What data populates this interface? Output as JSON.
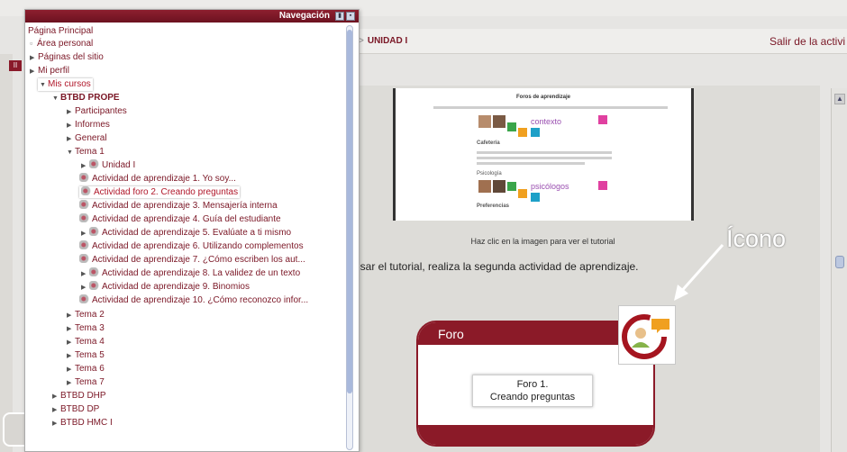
{
  "page": {
    "breadcrumb_sep": "i >",
    "breadcrumb": "UNIDAD I",
    "logout": "Salir de la activi",
    "left_badge": "II"
  },
  "nav": {
    "title": "Navegación",
    "items": [
      {
        "label": "Página Principal"
      },
      {
        "label": "Área personal"
      },
      {
        "label": "Páginas del sitio"
      },
      {
        "label": "Mi perfil"
      },
      {
        "label": "Mis cursos"
      },
      {
        "label": "BTBD PROPE"
      },
      {
        "label": "Participantes"
      },
      {
        "label": "Informes"
      },
      {
        "label": "General"
      },
      {
        "label": "Tema 1"
      },
      {
        "label": "Unidad I"
      },
      {
        "label": "Actividad de aprendizaje 1. Yo soy..."
      },
      {
        "label": "Actividad foro 2. Creando preguntas"
      },
      {
        "label": "Actividad de aprendizaje 3. Mensajería interna"
      },
      {
        "label": "Actividad de aprendizaje 4. Guía del estudiante"
      },
      {
        "label": "Actividad de aprendizaje 5. Evalúate a ti mismo"
      },
      {
        "label": "Actividad de aprendizaje 6. Utilizando complementos"
      },
      {
        "label": "Actividad de aprendizaje 7. ¿Cómo escriben los aut..."
      },
      {
        "label": "Actividad de aprendizaje 8. La validez de un texto"
      },
      {
        "label": "Actividad de aprendizaje 9. Binomios"
      },
      {
        "label": "Actividad de aprendizaje 10. ¿Cómo reconozco infor..."
      },
      {
        "label": "Tema 2"
      },
      {
        "label": "Tema 3"
      },
      {
        "label": "Tema 4"
      },
      {
        "label": "Tema 5"
      },
      {
        "label": "Tema 6"
      },
      {
        "label": "Tema 7"
      },
      {
        "label": "BTBD DHP"
      },
      {
        "label": "BTBD DP"
      },
      {
        "label": "BTBD HMC I"
      }
    ]
  },
  "tutorial": {
    "title": "Foros de aprendizaje",
    "word1": "contexto",
    "word2": "psicólogos",
    "section1": "Cafetería",
    "section2": "Psicología",
    "section3": "Preferencias",
    "caption": "Haz clic en la imagen para ver el tutorial"
  },
  "instruction": "isar el tutorial, realiza la segunda actividad de aprendizaje.",
  "foro": {
    "title": "Foro",
    "box_line1": "Foro 1.",
    "box_line2": "Creando preguntas"
  },
  "annotation": {
    "label": "Ícono"
  },
  "colors": {
    "maroon": "#8b1a28",
    "link": "#7b1726"
  }
}
